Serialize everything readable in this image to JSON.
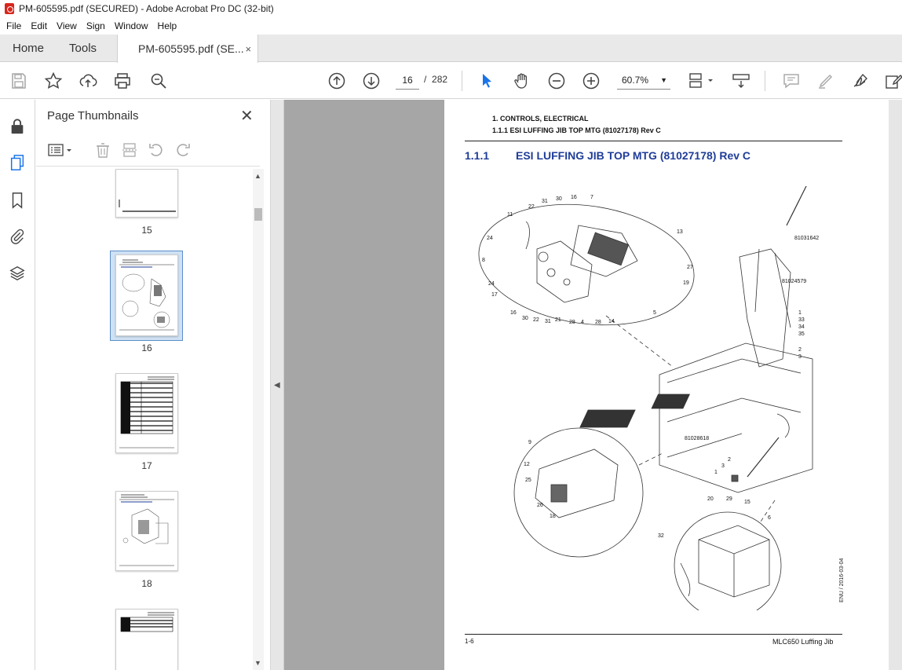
{
  "window": {
    "title": "PM-605595.pdf (SECURED) - Adobe Acrobat Pro DC (32-bit)"
  },
  "menu": [
    "File",
    "Edit",
    "View",
    "Sign",
    "Window",
    "Help"
  ],
  "tabs": {
    "home": "Home",
    "tools": "Tools",
    "document": "PM-605595.pdf (SE...",
    "close": "×"
  },
  "toolbar": {
    "current_page": "16",
    "page_separator": "/",
    "total_pages": "282",
    "zoom": "60.7%",
    "icons": [
      "save-icon",
      "star-icon",
      "upload-icon",
      "print-icon",
      "zoom-search-icon",
      "page-up-icon",
      "page-down-icon",
      "select-arrow-icon",
      "hand-icon",
      "zoom-out-icon",
      "zoom-in-icon",
      "page-fit-icon",
      "scroll-mode-icon",
      "comment-icon",
      "highlight-icon",
      "sign-icon",
      "edit-icon"
    ]
  },
  "left_rail": {
    "icons": [
      "lock-icon",
      "pages-icon",
      "bookmark-icon",
      "attachment-icon",
      "layers-icon"
    ]
  },
  "thumbnails": {
    "header": "Page Thumbnails",
    "close": "✕",
    "pages": [
      {
        "label": "15"
      },
      {
        "label": "16"
      },
      {
        "label": "17"
      },
      {
        "label": "18"
      }
    ],
    "selected_page": "16"
  },
  "document": {
    "header_line1": "1. CONTROLS, ELECTRICAL",
    "header_line2": "1.1.1 ESI LUFFING JIB TOP MTG (81027178) Rev C",
    "section_number": "1.1.1",
    "section_title": "ESI LUFFING JIB TOP MTG (81027178) Rev C",
    "side_code": "ENU / 2016-03-04",
    "footer_page": "1-6",
    "footer_title": "MLC650 Luffing Jib",
    "callouts": [
      "7",
      "16",
      "30",
      "31",
      "22",
      "11",
      "24",
      "8",
      "24",
      "17",
      "16",
      "30",
      "22",
      "31",
      "21",
      "28",
      "4",
      "28",
      "14",
      "5",
      "19",
      "27",
      "13",
      "81031642",
      "81024579",
      "1",
      "33",
      "34",
      "35",
      "2",
      "3",
      "81028618",
      "9",
      "12",
      "25",
      "26",
      "18",
      "2",
      "3",
      "1",
      "20",
      "29",
      "15",
      "6",
      "32"
    ],
    "colors": {
      "heading": "#1f3d99"
    }
  }
}
